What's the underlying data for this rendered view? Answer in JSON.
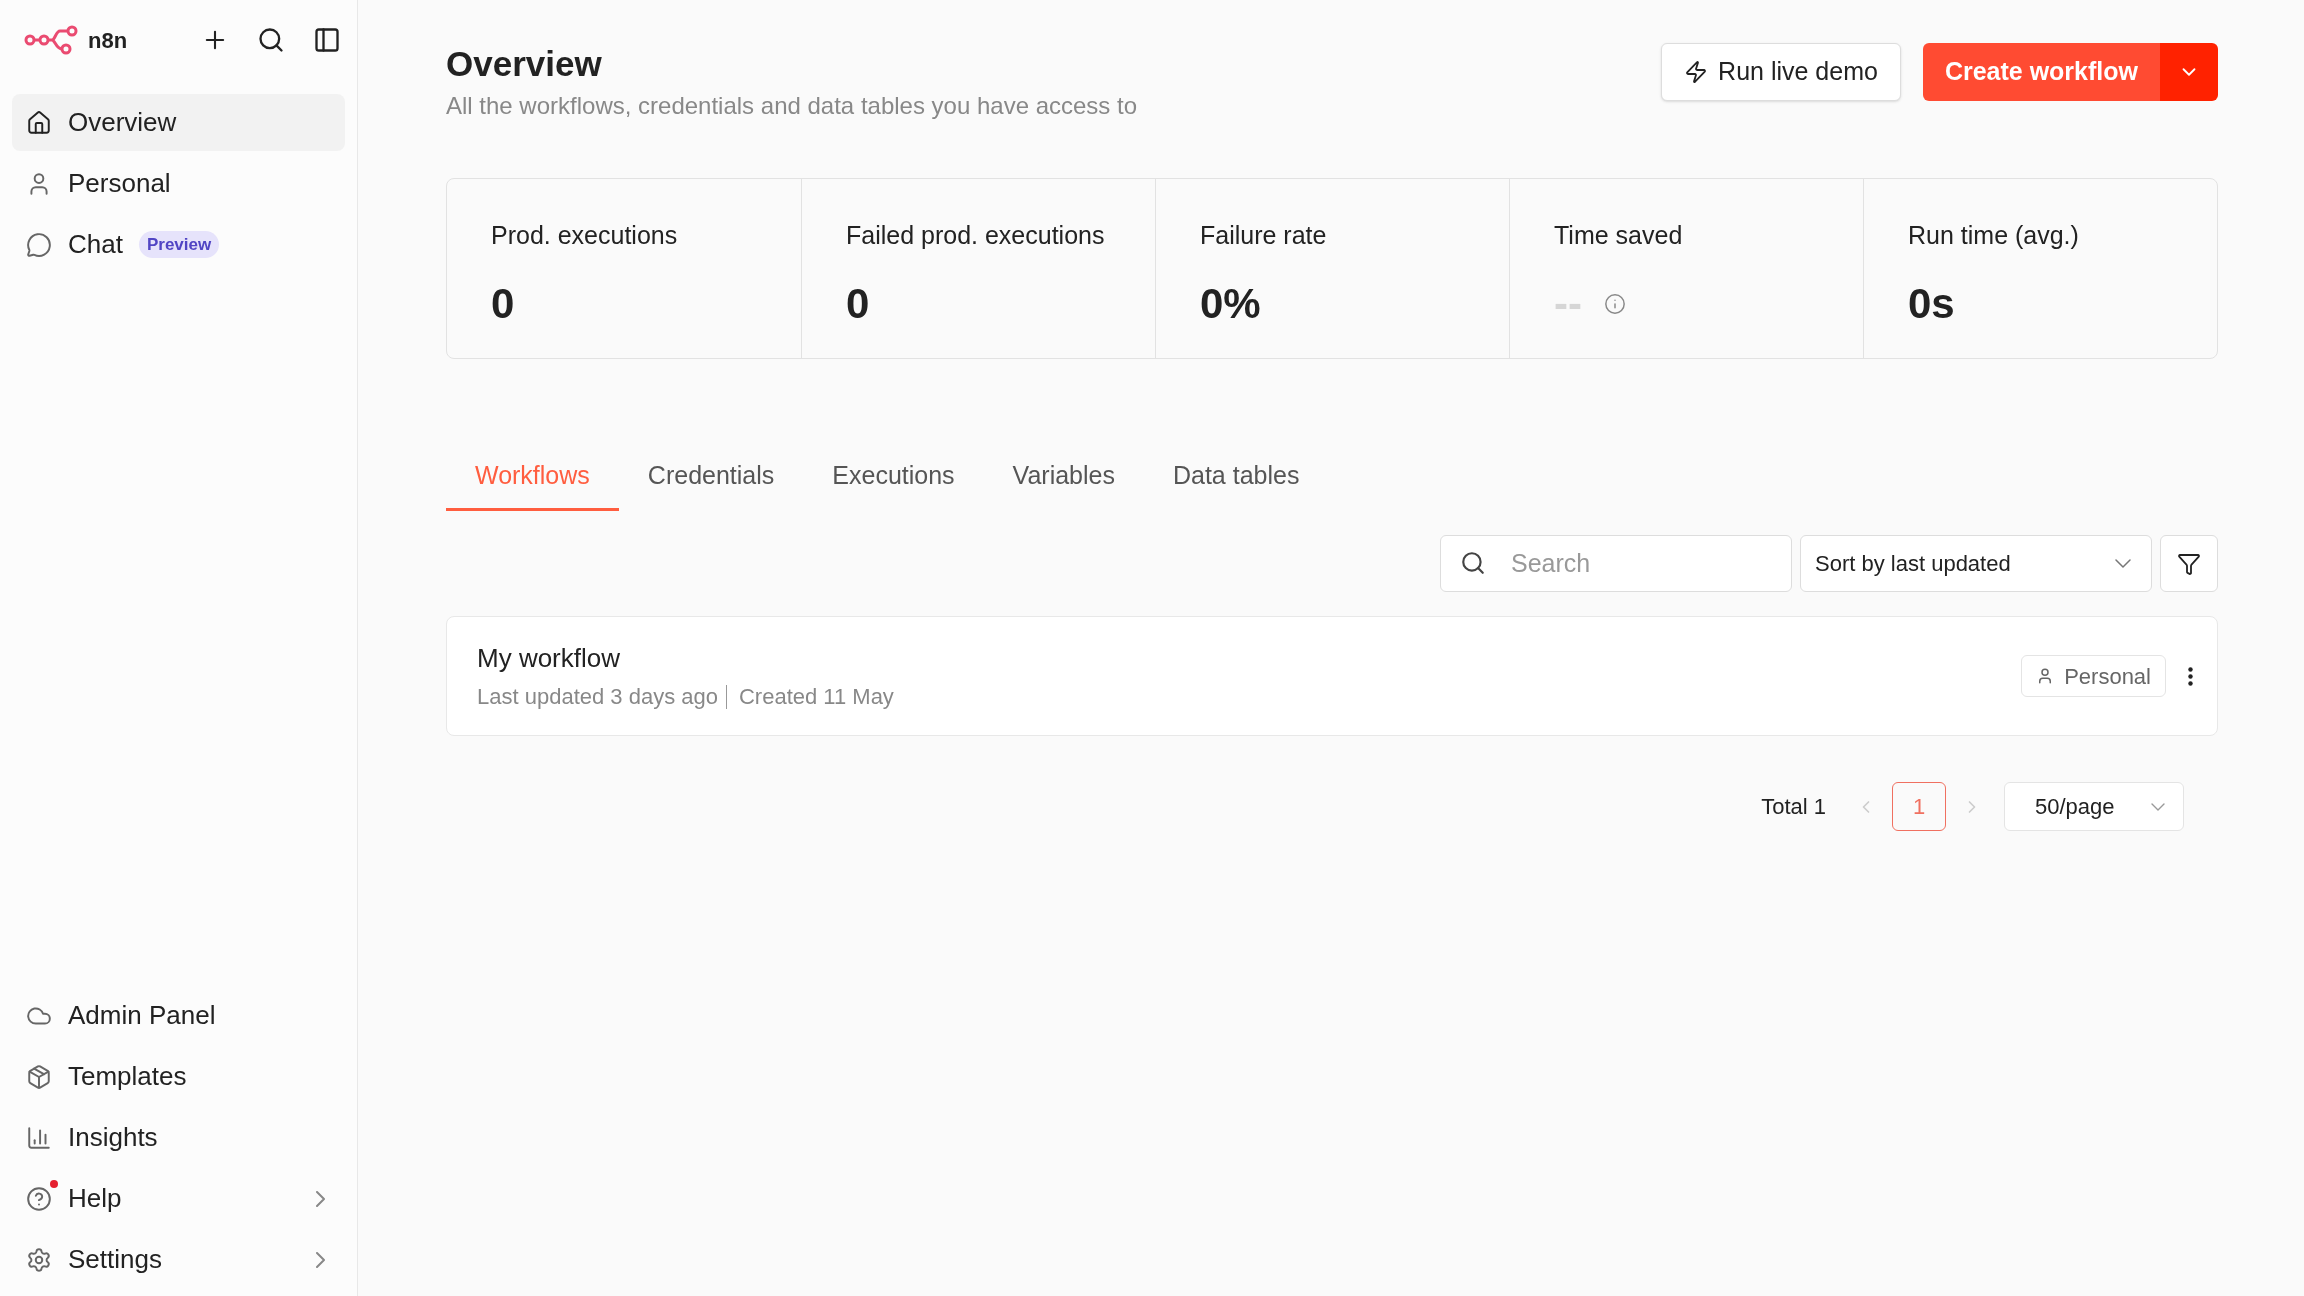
{
  "sidebar": {
    "logo_text": "n8n",
    "items": [
      {
        "label": "Overview",
        "selected": true
      },
      {
        "label": "Personal",
        "selected": false
      },
      {
        "label": "Chat",
        "selected": false,
        "badge": "Preview"
      }
    ],
    "bottom_items": [
      {
        "label": "Admin Panel",
        "expandable": false,
        "notification": false
      },
      {
        "label": "Templates",
        "expandable": false,
        "notification": false
      },
      {
        "label": "Insights",
        "expandable": false,
        "notification": false
      },
      {
        "label": "Help",
        "expandable": true,
        "notification": true
      },
      {
        "label": "Settings",
        "expandable": true,
        "notification": false
      }
    ]
  },
  "header": {
    "title": "Overview",
    "subtitle": "All the workflows, credentials and data tables you have access to",
    "demo_button": "Run live demo",
    "create_button": "Create workflow"
  },
  "stats": [
    {
      "label": "Prod. executions",
      "value": "0",
      "muted": false,
      "info": false
    },
    {
      "label": "Failed prod. executions",
      "value": "0",
      "muted": false,
      "info": false
    },
    {
      "label": "Failure rate",
      "value": "0%",
      "muted": false,
      "info": false
    },
    {
      "label": "Time saved",
      "value": "--",
      "muted": true,
      "info": true
    },
    {
      "label": "Run time (avg.)",
      "value": "0s",
      "muted": false,
      "info": false
    }
  ],
  "tabs": [
    {
      "label": "Workflows",
      "selected": true
    },
    {
      "label": "Credentials",
      "selected": false
    },
    {
      "label": "Executions",
      "selected": false
    },
    {
      "label": "Variables",
      "selected": false
    },
    {
      "label": "Data tables",
      "selected": false
    }
  ],
  "search": {
    "placeholder": "Search"
  },
  "sort": {
    "value": "Sort by last updated"
  },
  "workflows": [
    {
      "name": "My workflow",
      "updated": "Last updated 3 days ago",
      "created": "Created 11 May",
      "owner": "Personal"
    }
  ],
  "pagination": {
    "total": "Total 1",
    "pages": [
      {
        "label": "1",
        "selected": true
      }
    ],
    "page_size": "50/page"
  }
}
